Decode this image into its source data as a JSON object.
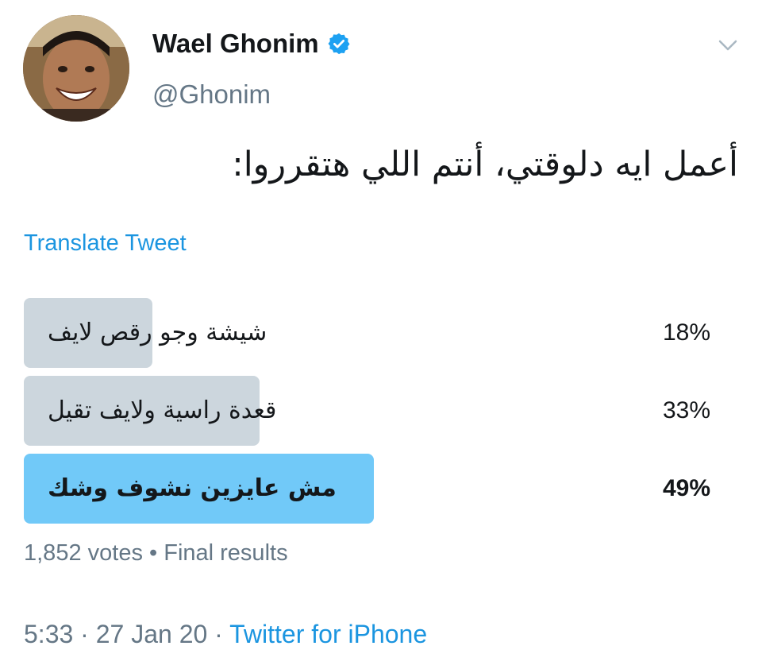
{
  "user": {
    "display_name": "Wael Ghonim",
    "handle": "@Ghonim",
    "verified_color": "#1da1f2"
  },
  "tweet": {
    "text": "أعمل ايه دلوقتي، أنتم اللي هتقرروا:",
    "translate_label": "Translate Tweet"
  },
  "poll": {
    "options": [
      {
        "label": "شيشة وجو رقص لايف",
        "percent_text": "18%",
        "share": 0.18,
        "winner": false
      },
      {
        "label": "قعدة راسية ولايف تقيل",
        "percent_text": "33%",
        "share": 0.33,
        "winner": false
      },
      {
        "label": "مش عايزين نشوف وشك",
        "percent_text": "49%",
        "share": 0.49,
        "winner": true
      }
    ],
    "votes": "1,852 votes",
    "separator": "•",
    "status": "Final results"
  },
  "meta": {
    "time": "5:33",
    "date": "27 Jan 20",
    "dot": "·",
    "source": "Twitter for iPhone"
  },
  "colors": {
    "link": "#1b95e0",
    "bar": "#ccd6dd",
    "bar_winner": "#71c9f8",
    "muted": "#657786"
  }
}
